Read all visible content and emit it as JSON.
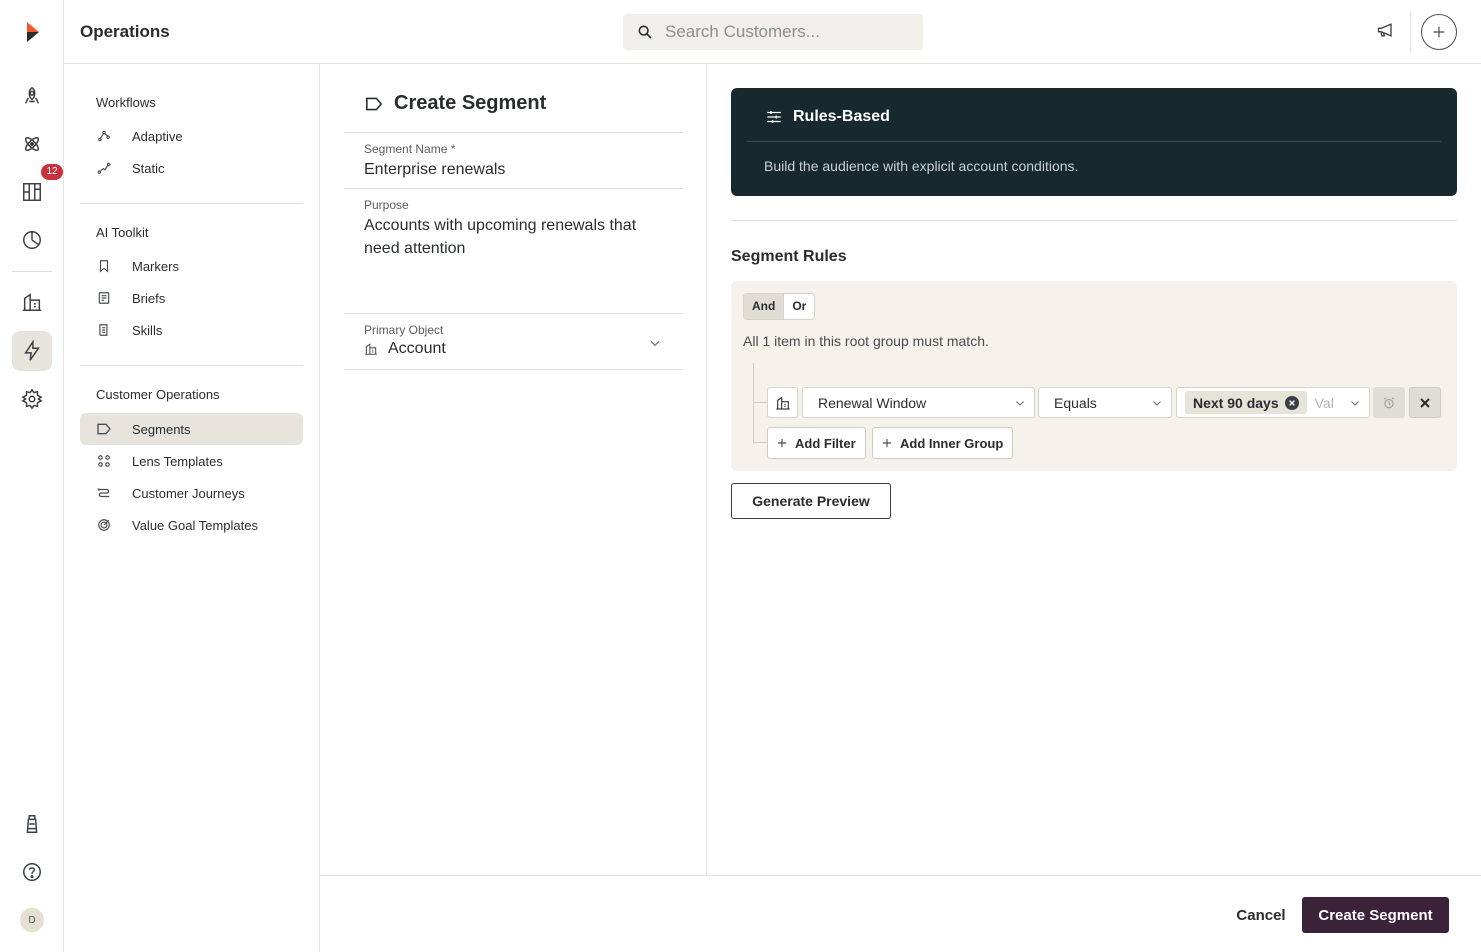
{
  "app": {
    "title": "Operations"
  },
  "search": {
    "placeholder": "Search Customers..."
  },
  "rail": {
    "notifications_badge": "12",
    "avatar_initial": "D"
  },
  "nav": {
    "workflows_title": "Workflows",
    "workflows": [
      {
        "label": "Adaptive",
        "icon": "adaptive-icon"
      },
      {
        "label": "Static",
        "icon": "static-icon"
      }
    ],
    "ai_toolkit_title": "AI Toolkit",
    "ai_toolkit": [
      {
        "label": "Markers",
        "icon": "bookmark-icon"
      },
      {
        "label": "Briefs",
        "icon": "brief-icon"
      },
      {
        "label": "Skills",
        "icon": "skills-icon"
      }
    ],
    "customer_ops_title": "Customer Operations",
    "customer_ops": [
      {
        "label": "Segments",
        "icon": "tag-icon",
        "active": true
      },
      {
        "label": "Lens Templates",
        "icon": "grid-icon"
      },
      {
        "label": "Customer Journeys",
        "icon": "journey-icon"
      },
      {
        "label": "Value Goal Templates",
        "icon": "target-icon"
      }
    ]
  },
  "form": {
    "title": "Create Segment",
    "segment_name_label": "Segment Name *",
    "segment_name_value": "Enterprise renewals",
    "purpose_label": "Purpose",
    "purpose_value": "Accounts with upcoming renewals that need attention",
    "primary_object_label": "Primary Object",
    "primary_object_value": "Account"
  },
  "rules": {
    "card_title": "Rules-Based",
    "card_description": "Build the audience with explicit account conditions.",
    "section_title": "Segment Rules",
    "and_label": "And",
    "or_label": "Or",
    "match_text": "All 1 item in this root group must match.",
    "filter_field": "Renewal Window",
    "filter_operator": "Equals",
    "filter_value_chip": "Next 90 days",
    "filter_value_placeholder": "Val",
    "add_filter_label": "Add Filter",
    "add_inner_group_label": "Add Inner Group",
    "generate_preview_label": "Generate Preview"
  },
  "footer": {
    "cancel_label": "Cancel",
    "create_label": "Create Segment"
  },
  "colors": {
    "accent_dark": "#17292f",
    "primary_button": "#3a2238",
    "badge": "#c8323c",
    "active_nav": "#e6e4dd"
  }
}
